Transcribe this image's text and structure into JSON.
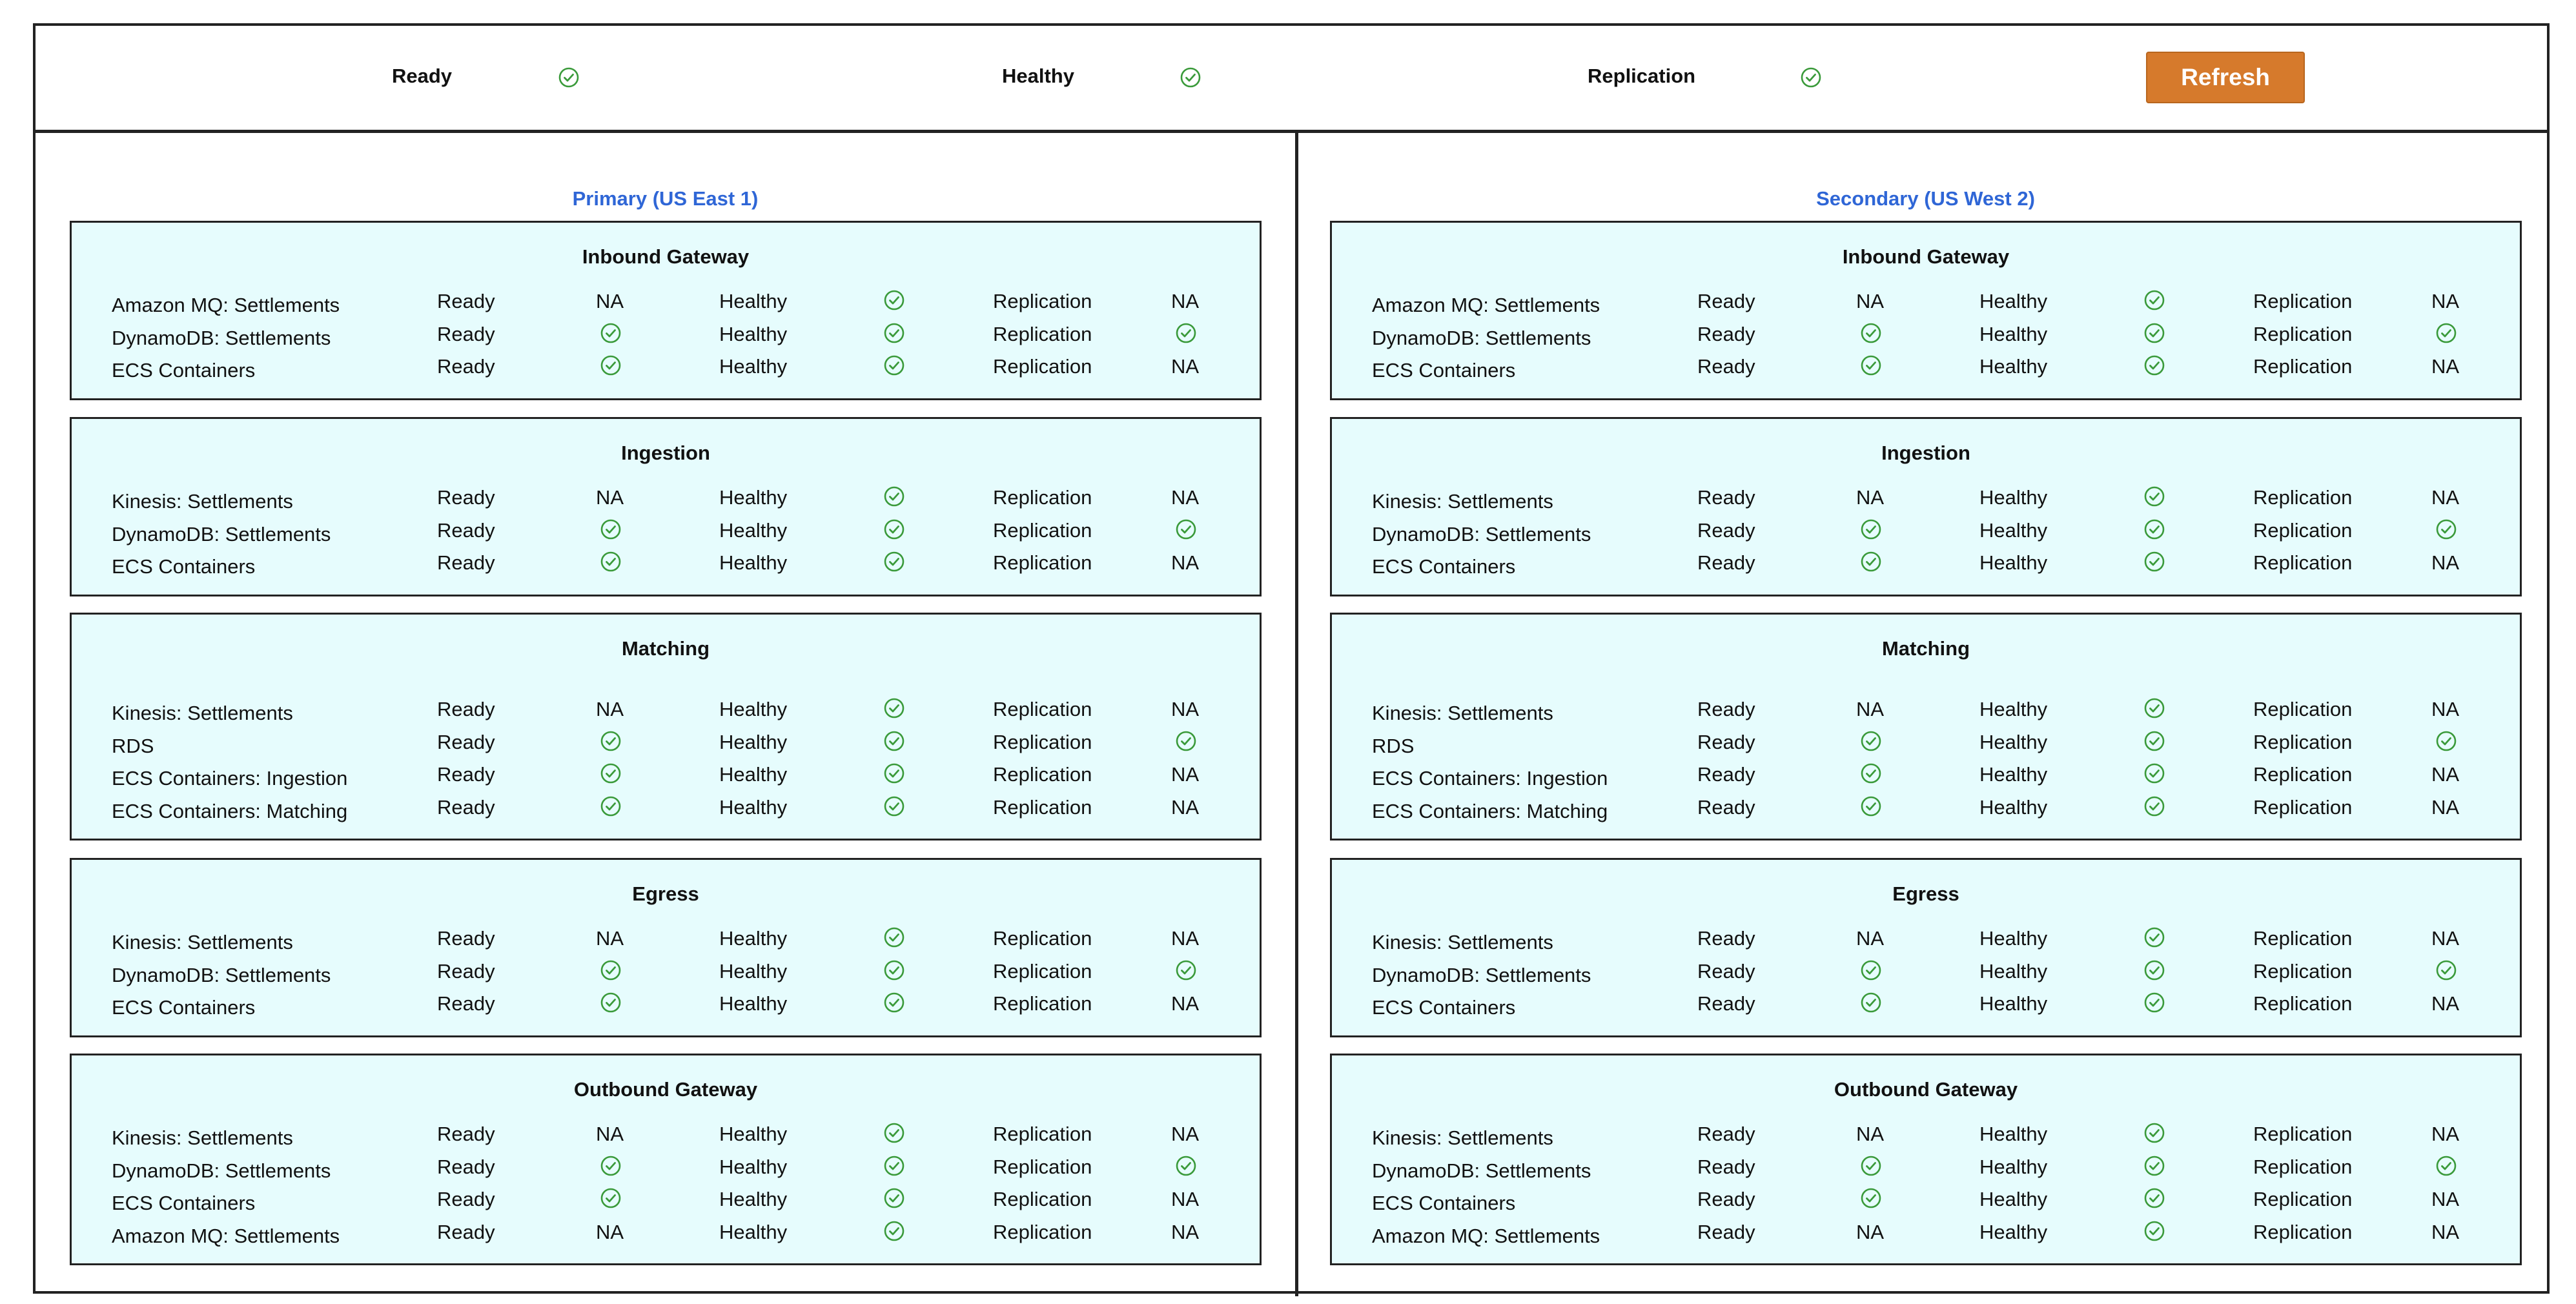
{
  "status_bar": {
    "ready_label": "Ready",
    "healthy_label": "Healthy",
    "replication_label": "Replication",
    "refresh_label": "Refresh"
  },
  "colors": {
    "check": "#3a9a3a",
    "region_title": "#2f66d6",
    "panel_bg": "#e6fcfd",
    "refresh_button": "#d67a2c"
  },
  "regions": [
    {
      "title": "Primary (US East 1)",
      "panels": [
        {
          "title": "Inbound Gateway",
          "rows": [
            {
              "name": "Amazon MQ: Settlements",
              "ready": "Ready",
              "ready_value": "NA",
              "healthy": "Healthy",
              "healthy_value": "check",
              "replication": "Replication",
              "replication_value": "NA"
            },
            {
              "name": "DynamoDB: Settlements",
              "ready": "Ready",
              "ready_value": "check",
              "healthy": "Healthy",
              "healthy_value": "check",
              "replication": "Replication",
              "replication_value": "check"
            },
            {
              "name": "ECS Containers",
              "ready": "Ready",
              "ready_value": "check",
              "healthy": "Healthy",
              "healthy_value": "check",
              "replication": "Replication",
              "replication_value": "NA"
            }
          ]
        },
        {
          "title": "Ingestion",
          "rows": [
            {
              "name": "Kinesis: Settlements",
              "ready": "Ready",
              "ready_value": "NA",
              "healthy": "Healthy",
              "healthy_value": "check",
              "replication": "Replication",
              "replication_value": "NA"
            },
            {
              "name": "DynamoDB: Settlements",
              "ready": "Ready",
              "ready_value": "check",
              "healthy": "Healthy",
              "healthy_value": "check",
              "replication": "Replication",
              "replication_value": "check"
            },
            {
              "name": "ECS Containers",
              "ready": "Ready",
              "ready_value": "check",
              "healthy": "Healthy",
              "healthy_value": "check",
              "replication": "Replication",
              "replication_value": "NA"
            }
          ]
        },
        {
          "title": "Matching",
          "rows": [
            {
              "name": "Kinesis: Settlements",
              "ready": "Ready",
              "ready_value": "NA",
              "healthy": "Healthy",
              "healthy_value": "check",
              "replication": "Replication",
              "replication_value": "NA"
            },
            {
              "name": "RDS",
              "ready": "Ready",
              "ready_value": "check",
              "healthy": "Healthy",
              "healthy_value": "check",
              "replication": "Replication",
              "replication_value": "check"
            },
            {
              "name": "ECS Containers: Ingestion",
              "ready": "Ready",
              "ready_value": "check",
              "healthy": "Healthy",
              "healthy_value": "check",
              "replication": "Replication",
              "replication_value": "NA"
            },
            {
              "name": "ECS Containers: Matching",
              "ready": "Ready",
              "ready_value": "check",
              "healthy": "Healthy",
              "healthy_value": "check",
              "replication": "Replication",
              "replication_value": "NA"
            }
          ]
        },
        {
          "title": "Egress",
          "rows": [
            {
              "name": "Kinesis: Settlements",
              "ready": "Ready",
              "ready_value": "NA",
              "healthy": "Healthy",
              "healthy_value": "check",
              "replication": "Replication",
              "replication_value": "NA"
            },
            {
              "name": "DynamoDB: Settlements",
              "ready": "Ready",
              "ready_value": "check",
              "healthy": "Healthy",
              "healthy_value": "check",
              "replication": "Replication",
              "replication_value": "check"
            },
            {
              "name": "ECS Containers",
              "ready": "Ready",
              "ready_value": "check",
              "healthy": "Healthy",
              "healthy_value": "check",
              "replication": "Replication",
              "replication_value": "NA"
            }
          ]
        },
        {
          "title": "Outbound Gateway",
          "rows": [
            {
              "name": "Kinesis: Settlements",
              "ready": "Ready",
              "ready_value": "NA",
              "healthy": "Healthy",
              "healthy_value": "check",
              "replication": "Replication",
              "replication_value": "NA"
            },
            {
              "name": "DynamoDB: Settlements",
              "ready": "Ready",
              "ready_value": "check",
              "healthy": "Healthy",
              "healthy_value": "check",
              "replication": "Replication",
              "replication_value": "check"
            },
            {
              "name": "ECS Containers",
              "ready": "Ready",
              "ready_value": "check",
              "healthy": "Healthy",
              "healthy_value": "check",
              "replication": "Replication",
              "replication_value": "NA"
            },
            {
              "name": "Amazon MQ: Settlements",
              "ready": "Ready",
              "ready_value": "NA",
              "healthy": "Healthy",
              "healthy_value": "check",
              "replication": "Replication",
              "replication_value": "NA"
            }
          ]
        }
      ]
    },
    {
      "title": "Secondary (US West 2)",
      "panels": [
        {
          "title": "Inbound Gateway",
          "rows": [
            {
              "name": "Amazon MQ: Settlements",
              "ready": "Ready",
              "ready_value": "NA",
              "healthy": "Healthy",
              "healthy_value": "check",
              "replication": "Replication",
              "replication_value": "NA"
            },
            {
              "name": "DynamoDB: Settlements",
              "ready": "Ready",
              "ready_value": "check",
              "healthy": "Healthy",
              "healthy_value": "check",
              "replication": "Replication",
              "replication_value": "check"
            },
            {
              "name": "ECS Containers",
              "ready": "Ready",
              "ready_value": "check",
              "healthy": "Healthy",
              "healthy_value": "check",
              "replication": "Replication",
              "replication_value": "NA"
            }
          ]
        },
        {
          "title": "Ingestion",
          "rows": [
            {
              "name": "Kinesis: Settlements",
              "ready": "Ready",
              "ready_value": "NA",
              "healthy": "Healthy",
              "healthy_value": "check",
              "replication": "Replication",
              "replication_value": "NA"
            },
            {
              "name": "DynamoDB: Settlements",
              "ready": "Ready",
              "ready_value": "check",
              "healthy": "Healthy",
              "healthy_value": "check",
              "replication": "Replication",
              "replication_value": "check"
            },
            {
              "name": "ECS Containers",
              "ready": "Ready",
              "ready_value": "check",
              "healthy": "Healthy",
              "healthy_value": "check",
              "replication": "Replication",
              "replication_value": "NA"
            }
          ]
        },
        {
          "title": "Matching",
          "rows": [
            {
              "name": "Kinesis: Settlements",
              "ready": "Ready",
              "ready_value": "NA",
              "healthy": "Healthy",
              "healthy_value": "check",
              "replication": "Replication",
              "replication_value": "NA"
            },
            {
              "name": "RDS",
              "ready": "Ready",
              "ready_value": "check",
              "healthy": "Healthy",
              "healthy_value": "check",
              "replication": "Replication",
              "replication_value": "check"
            },
            {
              "name": "ECS Containers: Ingestion",
              "ready": "Ready",
              "ready_value": "check",
              "healthy": "Healthy",
              "healthy_value": "check",
              "replication": "Replication",
              "replication_value": "NA"
            },
            {
              "name": "ECS Containers: Matching",
              "ready": "Ready",
              "ready_value": "check",
              "healthy": "Healthy",
              "healthy_value": "check",
              "replication": "Replication",
              "replication_value": "NA"
            }
          ]
        },
        {
          "title": "Egress",
          "rows": [
            {
              "name": "Kinesis: Settlements",
              "ready": "Ready",
              "ready_value": "NA",
              "healthy": "Healthy",
              "healthy_value": "check",
              "replication": "Replication",
              "replication_value": "NA"
            },
            {
              "name": "DynamoDB: Settlements",
              "ready": "Ready",
              "ready_value": "check",
              "healthy": "Healthy",
              "healthy_value": "check",
              "replication": "Replication",
              "replication_value": "check"
            },
            {
              "name": "ECS Containers",
              "ready": "Ready",
              "ready_value": "check",
              "healthy": "Healthy",
              "healthy_value": "check",
              "replication": "Replication",
              "replication_value": "NA"
            }
          ]
        },
        {
          "title": "Outbound Gateway",
          "rows": [
            {
              "name": "Kinesis: Settlements",
              "ready": "Ready",
              "ready_value": "NA",
              "healthy": "Healthy",
              "healthy_value": "check",
              "replication": "Replication",
              "replication_value": "NA"
            },
            {
              "name": "DynamoDB: Settlements",
              "ready": "Ready",
              "ready_value": "check",
              "healthy": "Healthy",
              "healthy_value": "check",
              "replication": "Replication",
              "replication_value": "check"
            },
            {
              "name": "ECS Containers",
              "ready": "Ready",
              "ready_value": "check",
              "healthy": "Healthy",
              "healthy_value": "check",
              "replication": "Replication",
              "replication_value": "NA"
            },
            {
              "name": "Amazon MQ: Settlements",
              "ready": "Ready",
              "ready_value": "NA",
              "healthy": "Healthy",
              "healthy_value": "check",
              "replication": "Replication",
              "replication_value": "NA"
            }
          ]
        }
      ]
    }
  ]
}
